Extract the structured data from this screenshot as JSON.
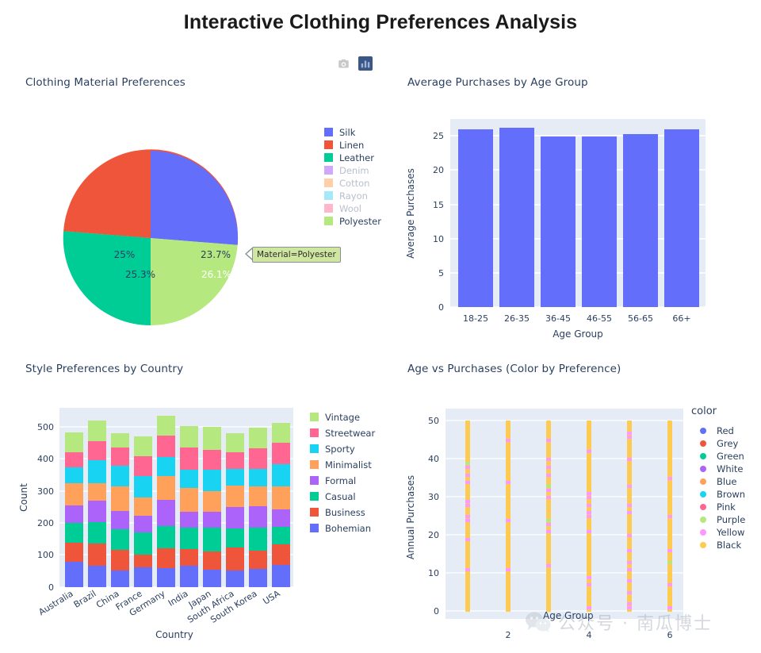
{
  "header": {
    "title": "Interactive Clothing Preferences Analysis"
  },
  "modebar": {
    "buttons": [
      {
        "name": "camera-icon",
        "label": "Download plot as a png",
        "active": false
      },
      {
        "name": "bar-chart-icon",
        "label": "Toggle chart type",
        "active": true
      }
    ]
  },
  "watermark": {
    "text": "公众号 · 南瓜博士"
  },
  "annotation": {
    "pie_tooltip": "Material=Polyester"
  },
  "colors": {
    "plot_bg": "#E5ECF6",
    "grid": "#FFFFFF",
    "text": "#2a3f5f",
    "dim_text": "#b8bfcc",
    "modebar_active": "#3b5786"
  },
  "chart_data": [
    {
      "id": "pie-materials",
      "type": "pie",
      "title": "Clothing Material Preferences",
      "legend_position": "right",
      "labels": [
        "Silk",
        "Linen",
        "Leather",
        "Denim",
        "Cotton",
        "Rayon",
        "Wool",
        "Polyester"
      ],
      "colors": [
        "#636EFA",
        "#EF553B",
        "#00CC96",
        "#AB63FA",
        "#FFA15A",
        "#19D3F3",
        "#FF6692",
        "#B6E880"
      ],
      "visible": [
        true,
        true,
        true,
        false,
        false,
        false,
        false,
        true
      ],
      "slices": [
        {
          "label": "Silk",
          "percent": 26.1,
          "percent_text": "26.1%",
          "color": "#636EFA",
          "label_color": "#FFFFFF"
        },
        {
          "label": "Linen",
          "percent": 25.3,
          "percent_text": "25.3%",
          "color": "#EF553B",
          "label_color": "#2a3f5f"
        },
        {
          "label": "Leather",
          "percent": 25.0,
          "percent_text": "25%",
          "color": "#00CC96",
          "label_color": "#2a3f5f"
        },
        {
          "label": "Polyester",
          "percent": 23.7,
          "percent_text": "23.7%",
          "color": "#B6E880",
          "label_color": "#2a3f5f"
        }
      ]
    },
    {
      "id": "bar-avg-purchases",
      "type": "bar",
      "title": "Average Purchases by Age Group",
      "xlabel": "Age Group",
      "ylabel": "Average Purchases",
      "categories": [
        "18-25",
        "26-35",
        "36-45",
        "46-55",
        "56-65",
        "66+"
      ],
      "values": [
        26.0,
        26.2,
        24.9,
        25.0,
        25.3,
        26.0
      ],
      "yticks": [
        0,
        5,
        10,
        15,
        20,
        25
      ],
      "ylim": [
        0,
        27.5
      ],
      "bar_color": "#636EFA",
      "grid": true
    },
    {
      "id": "stacked-style-country",
      "type": "bar",
      "title": "Style Preferences by Country",
      "xlabel": "Country",
      "ylabel": "Count",
      "stacked": true,
      "categories": [
        "Australia",
        "Brazil",
        "China",
        "France",
        "Germany",
        "India",
        "Japan",
        "South Africa",
        "South Korea",
        "USA"
      ],
      "yticks": [
        0,
        100,
        200,
        300,
        400,
        500
      ],
      "ylim": [
        0,
        560
      ],
      "legend_position": "right",
      "series": [
        {
          "name": "Bohemian",
          "color": "#636EFA",
          "values": [
            80,
            66,
            51,
            62,
            59,
            67,
            54,
            53,
            56,
            69
          ]
        },
        {
          "name": "Business",
          "color": "#EF553B",
          "values": [
            59,
            69,
            65,
            41,
            61,
            52,
            57,
            72,
            57,
            64
          ]
        },
        {
          "name": "Casual",
          "color": "#00CC96",
          "values": [
            62,
            67,
            64,
            68,
            69,
            67,
            75,
            60,
            71,
            56
          ]
        },
        {
          "name": "Formal",
          "color": "#AB63FA",
          "values": [
            56,
            67,
            58,
            52,
            81,
            49,
            49,
            65,
            68,
            54
          ]
        },
        {
          "name": "Minimalist",
          "color": "#FFA15A",
          "values": [
            68,
            54,
            76,
            58,
            75,
            75,
            65,
            67,
            62,
            72
          ]
        },
        {
          "name": "Sporty",
          "color": "#19D3F3",
          "values": [
            49,
            71,
            65,
            67,
            59,
            57,
            68,
            52,
            53,
            68
          ]
        },
        {
          "name": "Streetwear",
          "color": "#FF6692",
          "values": [
            48,
            59,
            56,
            61,
            67,
            68,
            61,
            52,
            64,
            67
          ]
        },
        {
          "name": "Vintage",
          "color": "#B6E880",
          "values": [
            62,
            64,
            46,
            61,
            61,
            68,
            72,
            60,
            64,
            62
          ]
        }
      ]
    },
    {
      "id": "scatter-age-purchases",
      "type": "scatter",
      "title": "Age vs Purchases (Color by Preference)",
      "xlabel": "Age Group",
      "ylabel": "Annual Purchases",
      "legend_title": "color",
      "legend_position": "right",
      "xticks": [
        2,
        4,
        6
      ],
      "xlim": [
        0.4,
        6.6
      ],
      "yticks": [
        0,
        10,
        20,
        30,
        40,
        50
      ],
      "ylim": [
        -2,
        53
      ],
      "categories": [
        {
          "name": "Red",
          "color": "#636EFA"
        },
        {
          "name": "Grey",
          "color": "#EF553B"
        },
        {
          "name": "Green",
          "color": "#00CC96"
        },
        {
          "name": "White",
          "color": "#AB63FA"
        },
        {
          "name": "Blue",
          "color": "#FFA15A"
        },
        {
          "name": "Brown",
          "color": "#19D3F3"
        },
        {
          "name": "Pink",
          "color": "#FF6692"
        },
        {
          "name": "Purple",
          "color": "#B6E880"
        },
        {
          "name": "Yellow",
          "color": "#FF97FF"
        },
        {
          "name": "Black",
          "color": "#FECB52"
        }
      ],
      "columns": [
        1,
        2,
        3,
        4,
        5,
        6
      ],
      "note": "Each age-group column is a dense vertical strip of points from 0 to 50; most points are 'Black' (#FECB52) with scattered 'Yellow' (#FF97FF) and a few 'Purple' (#B6E880).",
      "highlight_points": [
        {
          "x": 1,
          "y": [
            38,
            36,
            34,
            29,
            28,
            25,
            24,
            19,
            11
          ],
          "color": "#FF97FF"
        },
        {
          "x": 1,
          "y": [
            38
          ],
          "color": "#B6E880"
        },
        {
          "x": 2,
          "y": [
            45,
            34,
            24,
            11
          ],
          "color": "#FF97FF"
        },
        {
          "x": 3,
          "y": [
            45,
            40,
            38,
            36,
            32,
            30,
            24,
            22,
            12
          ],
          "color": "#FF97FF"
        },
        {
          "x": 3,
          "y": [
            32,
            24
          ],
          "color": "#B6E880"
        },
        {
          "x": 4,
          "y": [
            42,
            31,
            30,
            28,
            26,
            25,
            21,
            9,
            7,
            1
          ],
          "color": "#FF97FF"
        },
        {
          "x": 5,
          "y": [
            47,
            46,
            40,
            33,
            28,
            26,
            20,
            16,
            13,
            11,
            8,
            5,
            2,
            1
          ],
          "color": "#FF97FF"
        },
        {
          "x": 6,
          "y": [
            35,
            25,
            16,
            13,
            7,
            1
          ],
          "color": "#FF97FF"
        },
        {
          "x": 6,
          "y": [
            13
          ],
          "color": "#B6E880"
        }
      ]
    }
  ]
}
